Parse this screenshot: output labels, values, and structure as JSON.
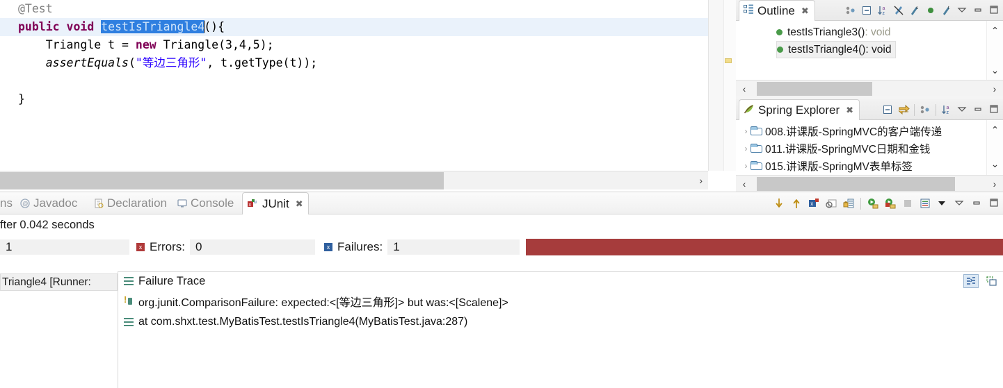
{
  "editor": {
    "name": "java-editor",
    "lines": [
      {
        "indent": 0,
        "highlight": false,
        "tokens": [
          {
            "t": "@Test",
            "c": "ann"
          }
        ]
      },
      {
        "indent": 0,
        "highlight": true,
        "tokens": [
          {
            "t": "public",
            "c": "kw"
          },
          {
            "t": " ",
            "c": ""
          },
          {
            "t": "void",
            "c": "kw"
          },
          {
            "t": " ",
            "c": ""
          },
          {
            "t": "testIsTriangle4",
            "c": "sel"
          },
          {
            "t": "(){",
            "c": ""
          }
        ]
      },
      {
        "indent": 1,
        "highlight": false,
        "tokens": [
          {
            "t": "Triangle t = ",
            "c": ""
          },
          {
            "t": "new",
            "c": "kw"
          },
          {
            "t": " Triangle(3,4,5);",
            "c": ""
          }
        ]
      },
      {
        "indent": 1,
        "highlight": false,
        "tokens": [
          {
            "t": "assertEquals",
            "c": "italic"
          },
          {
            "t": "(",
            "c": ""
          },
          {
            "t": "\"等边三角形\"",
            "c": "str"
          },
          {
            "t": ", t.getType(t));",
            "c": ""
          }
        ]
      },
      {
        "indent": 0,
        "highlight": false,
        "tokens": []
      },
      {
        "indent": 0,
        "highlight": false,
        "tokens": [
          {
            "t": "}",
            "c": ""
          }
        ]
      }
    ],
    "selected_text": "testIsTriangle4",
    "scroll_right_arrow": "›",
    "scroll_down_arrow": "⌄",
    "colors": {
      "keyword": "#7f0055",
      "string": "#2a00ff",
      "annotation": "#808080",
      "selection_bg": "#2f7fe0",
      "current_line_bg": "#eaf2fb"
    }
  },
  "outline": {
    "tab_label": "Outline",
    "tab_icon": "outline-icon",
    "close_glyph": "✖",
    "toolbar_icons": [
      "collapse-hierarchy-icon",
      "collapse-all-icon",
      "sort-alphabetically-icon",
      "hide-fields-icon",
      "hide-static-icon",
      "hide-nonpublic-icon",
      "hide-local-types-icon",
      "view-menu-icon",
      "minimize-icon",
      "maximize-icon"
    ],
    "items": [
      {
        "name": "testIsTriangle3()",
        "return": " : void",
        "selected": false,
        "dim_return": true
      },
      {
        "name": "testIsTriangle4()",
        "return": " : void",
        "selected": true,
        "dim_return": false
      }
    ],
    "scroll": {
      "up_arrow": "⌃",
      "down_arrow": "⌄",
      "left_arrow": "‹",
      "right_arrow": "›"
    }
  },
  "spring_explorer": {
    "tab_label": "Spring Explorer",
    "tab_icon": "spring-leaf-icon",
    "close_glyph": "✖",
    "toolbar_icons": [
      "collapse-all-icon",
      "link-with-editor-icon",
      "filter-icon",
      "sort-alphabetically-icon",
      "view-menu-icon",
      "minimize-icon",
      "maximize-icon"
    ],
    "items": [
      {
        "expander": "›",
        "icon": "folder-icon",
        "label": "008.讲课版-SpringMVC的客户端传递"
      },
      {
        "expander": "›",
        "icon": "folder-icon",
        "label": "011.讲课版-SpringMVC日期和金钱"
      },
      {
        "expander": "›",
        "icon": "folder-icon",
        "label": "015.讲课版-SpringMV表单标签"
      }
    ],
    "scroll": {
      "up_arrow": "⌃",
      "down_arrow": "⌄",
      "left_arrow": "‹",
      "right_arrow": "›"
    }
  },
  "junit": {
    "tabs": [
      {
        "label": "ns",
        "icon": "clipped-tab-icon",
        "active": false
      },
      {
        "label": "Javadoc",
        "icon": "javadoc-icon",
        "active": false
      },
      {
        "label": "Declaration",
        "icon": "declaration-icon",
        "active": false
      },
      {
        "label": "Console",
        "icon": "console-icon",
        "active": false
      },
      {
        "label": "JUnit",
        "icon": "junit-icon",
        "active": true
      }
    ],
    "tab_close_glyph": "✖",
    "toolbar_icons": [
      "next-failure-icon",
      "previous-failure-icon",
      "show-failures-only-icon",
      "stop-icon",
      "lock-history-icon",
      "rerun-test-icon",
      "rerun-failed-icon",
      "stop-run-icon",
      "test-history-icon",
      "view-menu-dropdown-icon",
      "view-menu-icon",
      "minimize-icon",
      "maximize-icon"
    ],
    "finished_text": "fter 0.042 seconds",
    "runs": {
      "label": "",
      "value": "1"
    },
    "errors": {
      "label": "Errors:",
      "value": "0"
    },
    "failures": {
      "label": "Failures:",
      "value": "1"
    },
    "progress": {
      "state": "failed",
      "color": "#a63c3c",
      "percent": 100
    },
    "run_tree": [
      {
        "label": "Triangle4 [Runner:",
        "selected": true
      }
    ],
    "failure_trace": {
      "header": "Failure Trace",
      "header_icon": "stack-lines-icon",
      "rows": [
        {
          "icon": "comparison-failure-icon",
          "text": "org.junit.ComparisonFailure: expected:<[等边三角形]> but was:<[Scalene]>"
        },
        {
          "icon": "stack-lines-icon",
          "text": "at com.shxt.test.MyBatisTest.testIsTriangle4(MyBatisTest.java:287)"
        }
      ],
      "tools": [
        "compare-results-icon",
        "copy-trace-icon"
      ]
    }
  }
}
